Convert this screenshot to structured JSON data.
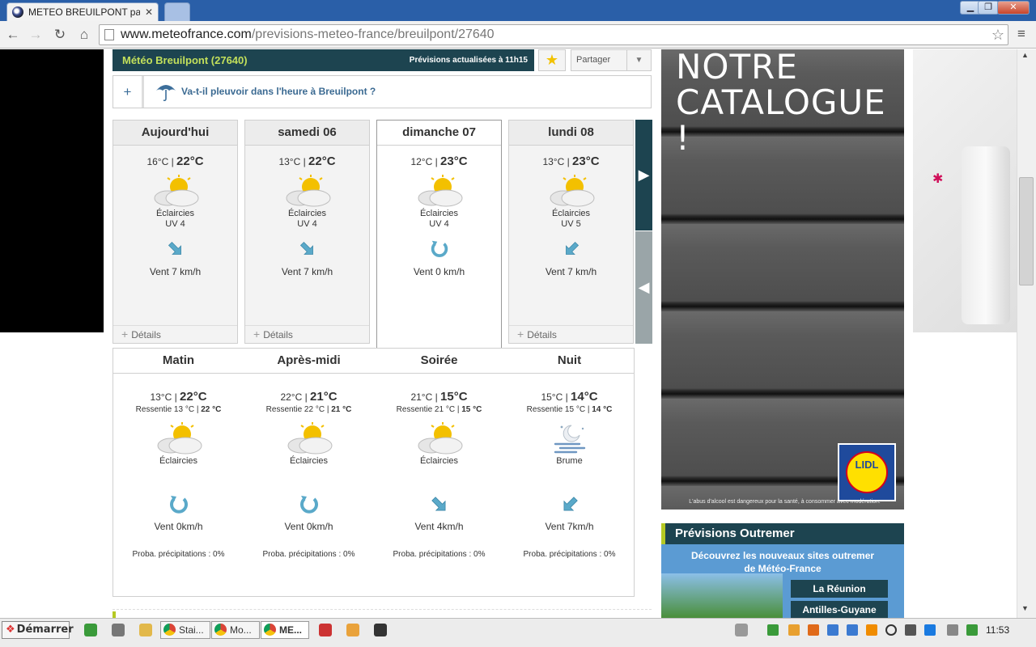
{
  "browser": {
    "tab_title": "METEO BREUILPONT pa",
    "url_host": "www.meteofrance.com",
    "url_path": "/previsions-meteo-france/breuilpont/27640"
  },
  "header": {
    "location": "Météo Breuilpont (27640)",
    "updated": "Prévisions actualisées à 11h15",
    "share_label": "Partager"
  },
  "rain": {
    "plus": "+",
    "question": "Va-t-il pleuvoir dans l'heure à Breuilpont ?"
  },
  "days": [
    {
      "name": "Aujourd'hui",
      "tmin": "16°C",
      "tmax": "22°C",
      "cond": "Éclaircies",
      "uv": "UV 4",
      "wind": "Vent 7 km/h",
      "wind_icon": "arrow-down-right",
      "details": "Détails",
      "active": false
    },
    {
      "name": "samedi 06",
      "tmin": "13°C",
      "tmax": "22°C",
      "cond": "Éclaircies",
      "uv": "UV 4",
      "wind": "Vent 7 km/h",
      "wind_icon": "arrow-down-right",
      "details": "Détails",
      "active": false
    },
    {
      "name": "dimanche 07",
      "tmin": "12°C",
      "tmax": "23°C",
      "cond": "Éclaircies",
      "uv": "UV 4",
      "wind": "Vent 0 km/h",
      "wind_icon": "calm-circle",
      "details": "",
      "active": true
    },
    {
      "name": "lundi 08",
      "tmin": "13°C",
      "tmax": "23°C",
      "cond": "Éclaircies",
      "uv": "UV 5",
      "wind": "Vent 7 km/h",
      "wind_icon": "arrow-down-left",
      "details": "Détails",
      "active": false
    }
  ],
  "periods": [
    {
      "name": "Matin",
      "tmin": "13°C",
      "tmax": "22°C",
      "feel_prefix": "Ressentie 13 °C",
      "feel_max": "22 °C",
      "cond": "Éclaircies",
      "icon": "sun-cloud",
      "wind": "Vent 0km/h",
      "wind_icon": "calm-circle",
      "proba": "Proba. précipitations : 0%"
    },
    {
      "name": "Après-midi",
      "tmin": "22°C",
      "tmax": "21°C",
      "feel_prefix": "Ressentie 22 °C",
      "feel_max": "21 °C",
      "cond": "Éclaircies",
      "icon": "sun-cloud",
      "wind": "Vent 0km/h",
      "wind_icon": "calm-circle",
      "proba": "Proba. précipitations : 0%"
    },
    {
      "name": "Soirée",
      "tmin": "21°C",
      "tmax": "15°C",
      "feel_prefix": "Ressentie 21 °C",
      "feel_max": "15 °C",
      "cond": "Éclaircies",
      "icon": "sun-cloud",
      "wind": "Vent 4km/h",
      "wind_icon": "arrow-down-right",
      "proba": "Proba. précipitations : 0%"
    },
    {
      "name": "Nuit",
      "tmin": "15°C",
      "tmax": "14°C",
      "feel_prefix": "Ressentie 15 °C",
      "feel_max": "14 °C",
      "cond": "Brume",
      "icon": "moon-mist",
      "wind": "Vent 7km/h",
      "wind_icon": "arrow-down-left",
      "proba": "Proba. précipitations : 0%"
    }
  ],
  "ad": {
    "title_line1": "NOTRE",
    "title_line2": "CATALOGUE !",
    "brand": "LIDL",
    "legal": "L'abus d'alcool est dangereux pour la santé, à consommer avec modération."
  },
  "outremer": {
    "title": "Prévisions Outremer",
    "text_line1": "Découvrez les nouveaux sites outremer",
    "text_line2": "de Météo-France",
    "button1": "La Réunion",
    "button2": "Antilles-Guyane"
  },
  "taskbar": {
    "start": "Démarrer",
    "tasks": [
      "Stai...",
      "Mo...",
      "ME..."
    ],
    "clock": "11:53"
  }
}
